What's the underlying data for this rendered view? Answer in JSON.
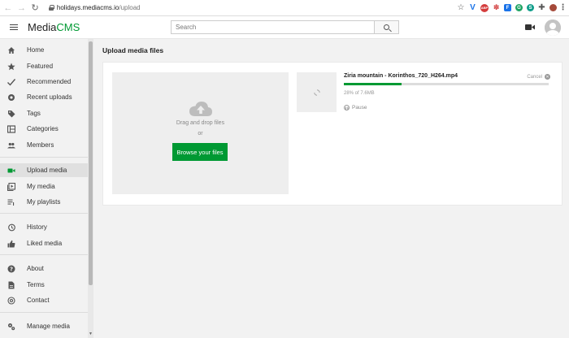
{
  "browser": {
    "url_domain": "holidays.mediacms.io",
    "url_path": "/upload",
    "back_glyph": "←",
    "forward_glyph": "→",
    "reload_glyph": "↻",
    "extensions": [
      {
        "name": "bookmark-star-icon",
        "glyph": "☆"
      },
      {
        "name": "extension-v-icon",
        "glyph": "V"
      },
      {
        "name": "adblock-icon",
        "glyph": "ABP"
      },
      {
        "name": "paw-extension-icon",
        "glyph": "✽"
      },
      {
        "name": "extension-f-icon",
        "glyph": "F"
      },
      {
        "name": "extension-g-icon",
        "glyph": "G"
      },
      {
        "name": "extension-s-icon",
        "glyph": "S"
      },
      {
        "name": "extensions-puzzle-icon",
        "glyph": "✚"
      },
      {
        "name": "profile-avatar-icon",
        "glyph": ""
      },
      {
        "name": "browser-menu-icon",
        "glyph": "⋮"
      }
    ]
  },
  "header": {
    "logo_text": "Media",
    "logo_accent": "CMS",
    "search_placeholder": "Search"
  },
  "sidebar": {
    "items": [
      {
        "label": "Home",
        "icon": "home-icon"
      },
      {
        "label": "Featured",
        "icon": "star-icon"
      },
      {
        "label": "Recommended",
        "icon": "check-icon"
      },
      {
        "label": "Recent uploads",
        "icon": "recent-icon"
      },
      {
        "label": "Tags",
        "icon": "tag-icon"
      },
      {
        "label": "Categories",
        "icon": "categories-icon"
      },
      {
        "label": "Members",
        "icon": "members-icon"
      },
      {
        "label": "Upload media",
        "icon": "video-camera-icon",
        "active": true
      },
      {
        "label": "My media",
        "icon": "video-library-icon"
      },
      {
        "label": "My playlists",
        "icon": "playlist-icon"
      },
      {
        "label": "History",
        "icon": "history-icon"
      },
      {
        "label": "Liked media",
        "icon": "thumbs-up-icon"
      },
      {
        "label": "About",
        "icon": "help-icon"
      },
      {
        "label": "Terms",
        "icon": "document-icon"
      },
      {
        "label": "Contact",
        "icon": "at-sign-icon"
      },
      {
        "label": "Manage media",
        "icon": "gears-icon"
      }
    ]
  },
  "main": {
    "page_title": "Upload media files",
    "dropzone": {
      "drag_text": "Drag and drop files",
      "or_text": "or",
      "browse_label": "Browse your files"
    },
    "file": {
      "name": "Ziria mountain - Korinthos_720_H264.mp4",
      "cancel_label": "Cancel",
      "progress_text": "28% of 7.6MB",
      "progress_fraction": 0.28,
      "pause_label": "Pause"
    }
  },
  "colors": {
    "accent": "#009933",
    "active_sidebar_bg": "#e0e0e0"
  }
}
